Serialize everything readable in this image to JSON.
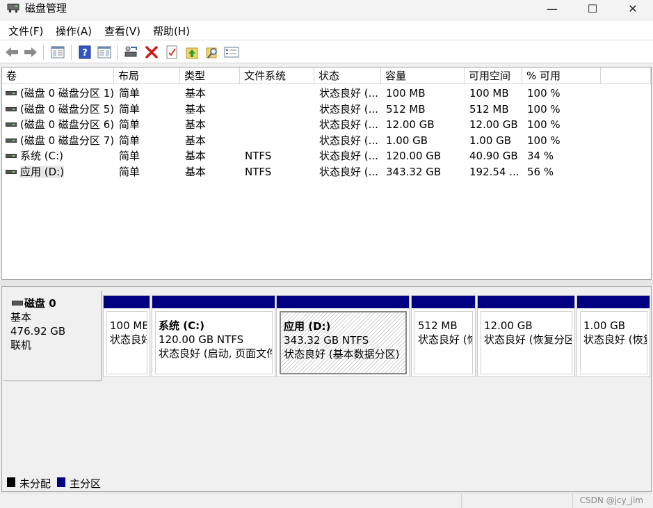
{
  "window": {
    "title": "磁盘管理",
    "minimize": "—",
    "maximize": "☐",
    "close": "✕"
  },
  "menu": [
    "文件(F)",
    "操作(A)",
    "查看(V)",
    "帮助(H)"
  ],
  "toolbar": [
    "back-icon",
    "forward-icon",
    "console-tree-icon",
    "help-icon",
    "properties-pane-icon",
    "connect-disk-icon",
    "delete-icon",
    "checklist-icon",
    "upload-icon",
    "search-folder-icon",
    "settings-list-icon"
  ],
  "volumes": {
    "columns": [
      "卷",
      "布局",
      "类型",
      "文件系统",
      "状态",
      "容量",
      "可用空间",
      "% 可用"
    ],
    "rows": [
      [
        "(磁盘 0 磁盘分区 1)",
        "简单",
        "基本",
        "",
        "状态良好 (...",
        "100 MB",
        "100 MB",
        "100 %"
      ],
      [
        "(磁盘 0 磁盘分区 5)",
        "简单",
        "基本",
        "",
        "状态良好 (...",
        "512 MB",
        "512 MB",
        "100 %"
      ],
      [
        "(磁盘 0 磁盘分区 6)",
        "简单",
        "基本",
        "",
        "状态良好 (...",
        "12.00 GB",
        "12.00 GB",
        "100 %"
      ],
      [
        "(磁盘 0 磁盘分区 7)",
        "简单",
        "基本",
        "",
        "状态良好 (...",
        "1.00 GB",
        "1.00 GB",
        "100 %"
      ],
      [
        "系统 (C:)",
        "简单",
        "基本",
        "NTFS",
        "状态良好 (...",
        "120.00 GB",
        "40.90 GB",
        "34 %"
      ],
      [
        "应用 (D:)",
        "简单",
        "基本",
        "NTFS",
        "状态良好 (...",
        "343.32 GB",
        "192.54 ...",
        "56 %"
      ]
    ]
  },
  "disk": {
    "name": "磁盘 0",
    "type": "基本",
    "size": "476.92 GB",
    "status": "联机",
    "partitions": [
      {
        "name": "",
        "size": "100 MB",
        "status": "状态良好"
      },
      {
        "name": "系统 (C:)",
        "size": "120.00 GB NTFS",
        "status": "状态良好 (启动, 页面文件"
      },
      {
        "name": "应用 (D:)",
        "size": "343.32 GB NTFS",
        "status": "状态良好 (基本数据分区)"
      },
      {
        "name": "",
        "size": "512 MB",
        "status": "状态良好 (恢"
      },
      {
        "name": "",
        "size": "12.00 GB",
        "status": "状态良好 (恢复分区"
      },
      {
        "name": "",
        "size": "1.00 GB",
        "status": "状态良好 (恢复"
      }
    ]
  },
  "legend": [
    {
      "label": "未分配",
      "color": "#000000"
    },
    {
      "label": "主分区",
      "color": "#000080"
    }
  ],
  "watermark": "CSDN @jcy_jim",
  "colors": {
    "primary_partition": "#000080",
    "unallocated": "#000000"
  }
}
